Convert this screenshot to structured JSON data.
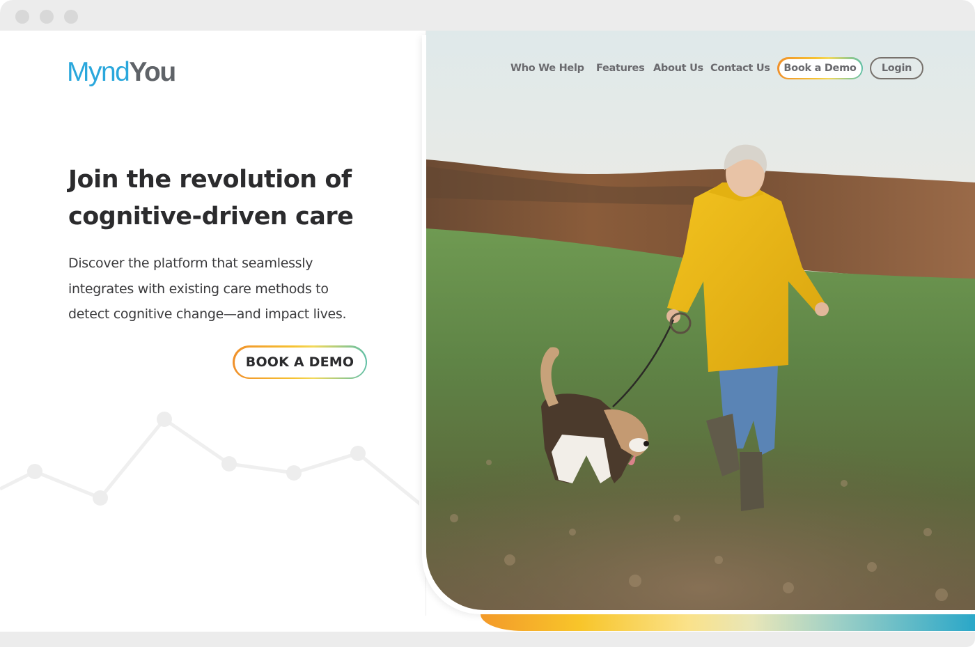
{
  "window": {
    "controls": [
      "close",
      "minimize",
      "maximize"
    ]
  },
  "brand": {
    "name_part1": "Mynd",
    "name_part2": "You",
    "color_primary": "#2aa7dc",
    "color_secondary": "#5f6368"
  },
  "nav": {
    "links": [
      {
        "label": "Who We Help"
      },
      {
        "label": "Features"
      },
      {
        "label": "About Us"
      },
      {
        "label": "Contact Us"
      }
    ],
    "book_demo_label": "Book a Demo",
    "login_label": "Login"
  },
  "hero": {
    "headline_line1": "Join the revolution of",
    "headline_line2": "cognitive-driven care",
    "sub_line1": "Discover the platform that seamlessly",
    "sub_line2": "integrates with existing care methods to",
    "sub_line3": "detect cognitive change—and impact lives.",
    "cta_label": "BOOK A DEMO",
    "image_alt": "Senior woman in yellow raincoat walking a beagle on a leash across an autumn field"
  },
  "accent_gradient": [
    "#f39a2a",
    "#f8c52a",
    "#fae28a",
    "#9fd0c6",
    "#2aa7c8"
  ]
}
